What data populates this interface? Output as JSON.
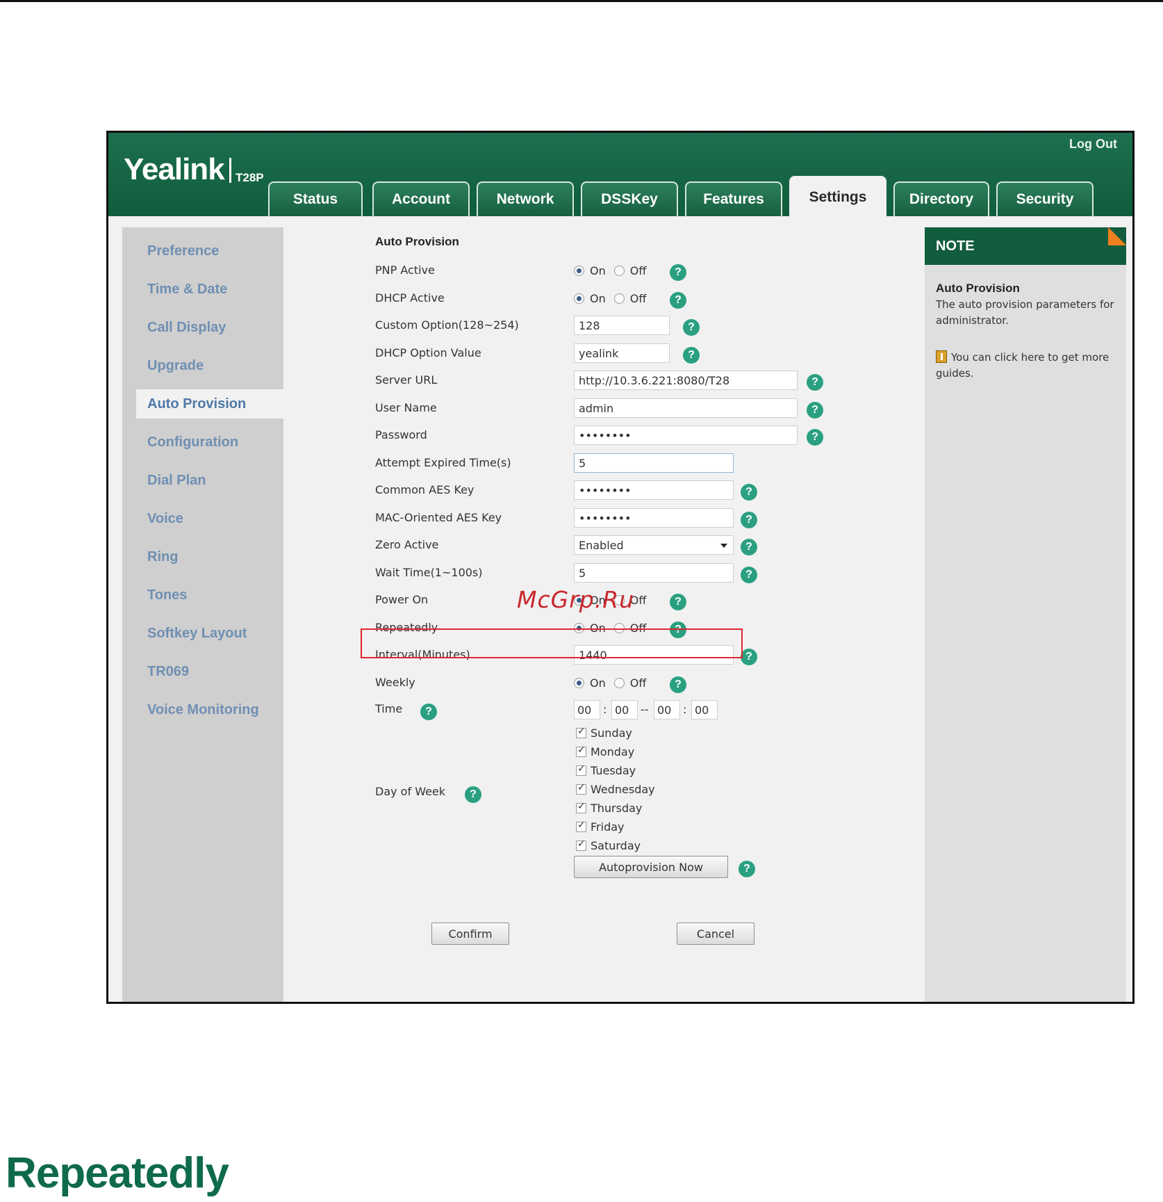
{
  "header": {
    "logo": "Yealink",
    "model": "T28P",
    "logout": "Log Out"
  },
  "tabs": [
    {
      "label": "Status"
    },
    {
      "label": "Account"
    },
    {
      "label": "Network"
    },
    {
      "label": "DSSKey"
    },
    {
      "label": "Features"
    },
    {
      "label": "Settings",
      "active": true
    },
    {
      "label": "Directory"
    },
    {
      "label": "Security"
    }
  ],
  "sidebar": {
    "items": [
      {
        "label": "Preference"
      },
      {
        "label": "Time & Date"
      },
      {
        "label": "Call Display"
      },
      {
        "label": "Upgrade"
      },
      {
        "label": "Auto Provision",
        "active": true
      },
      {
        "label": "Configuration"
      },
      {
        "label": "Dial Plan"
      },
      {
        "label": "Voice"
      },
      {
        "label": "Ring"
      },
      {
        "label": "Tones"
      },
      {
        "label": "Softkey Layout"
      },
      {
        "label": "TR069"
      },
      {
        "label": "Voice Monitoring"
      }
    ]
  },
  "form": {
    "section_title": "Auto Provision",
    "on_label": "On",
    "off_label": "Off",
    "help_glyph": "?",
    "pnp_active": {
      "label": "PNP Active",
      "value": "On"
    },
    "dhcp_active": {
      "label": "DHCP Active",
      "value": "On"
    },
    "custom_option": {
      "label": "Custom Option(128~254)",
      "value": "128"
    },
    "dhcp_option_value": {
      "label": "DHCP Option Value",
      "value": "yealink"
    },
    "server_url": {
      "label": "Server URL",
      "value": "http://10.3.6.221:8080/T28"
    },
    "user_name": {
      "label": "User Name",
      "value": "admin"
    },
    "password": {
      "label": "Password",
      "value": "••••••••"
    },
    "attempt_expired": {
      "label": "Attempt Expired Time(s)",
      "value": "5"
    },
    "common_aes": {
      "label": "Common AES Key",
      "value": "••••••••"
    },
    "mac_aes": {
      "label": "MAC-Oriented AES Key",
      "value": "••••••••"
    },
    "zero_active": {
      "label": "Zero Active",
      "value": "Enabled"
    },
    "wait_time": {
      "label": "Wait Time(1~100s)",
      "value": "5"
    },
    "power_on": {
      "label": "Power On",
      "value": "On"
    },
    "repeatedly": {
      "label": "Repeatedly",
      "value": "On"
    },
    "interval": {
      "label": "Interval(Minutes)",
      "value": "1440"
    },
    "weekly": {
      "label": "Weekly",
      "value": "On"
    },
    "time": {
      "label": "Time",
      "start_h": "00",
      "start_m": "00",
      "end_h": "00",
      "end_m": "00",
      "colon": ":",
      "dash": "--"
    },
    "day_of_week": {
      "label": "Day of Week",
      "days": [
        "Sunday",
        "Monday",
        "Tuesday",
        "Wednesday",
        "Thursday",
        "Friday",
        "Saturday"
      ]
    },
    "autoprovision_now": "Autoprovision Now",
    "confirm": "Confirm",
    "cancel": "Cancel"
  },
  "note": {
    "header": "NOTE",
    "title": "Auto Provision",
    "text": "The auto provision parameters for administrator.",
    "guide": "You can click here to get more guides."
  },
  "watermark": "McGrp.Ru",
  "page_heading": "Repeatedly",
  "colors": {
    "brand_green": "#0f5d3d",
    "help_teal": "#2aa081",
    "highlight_red": "#e0262e",
    "note_orange": "#f07f1d"
  }
}
